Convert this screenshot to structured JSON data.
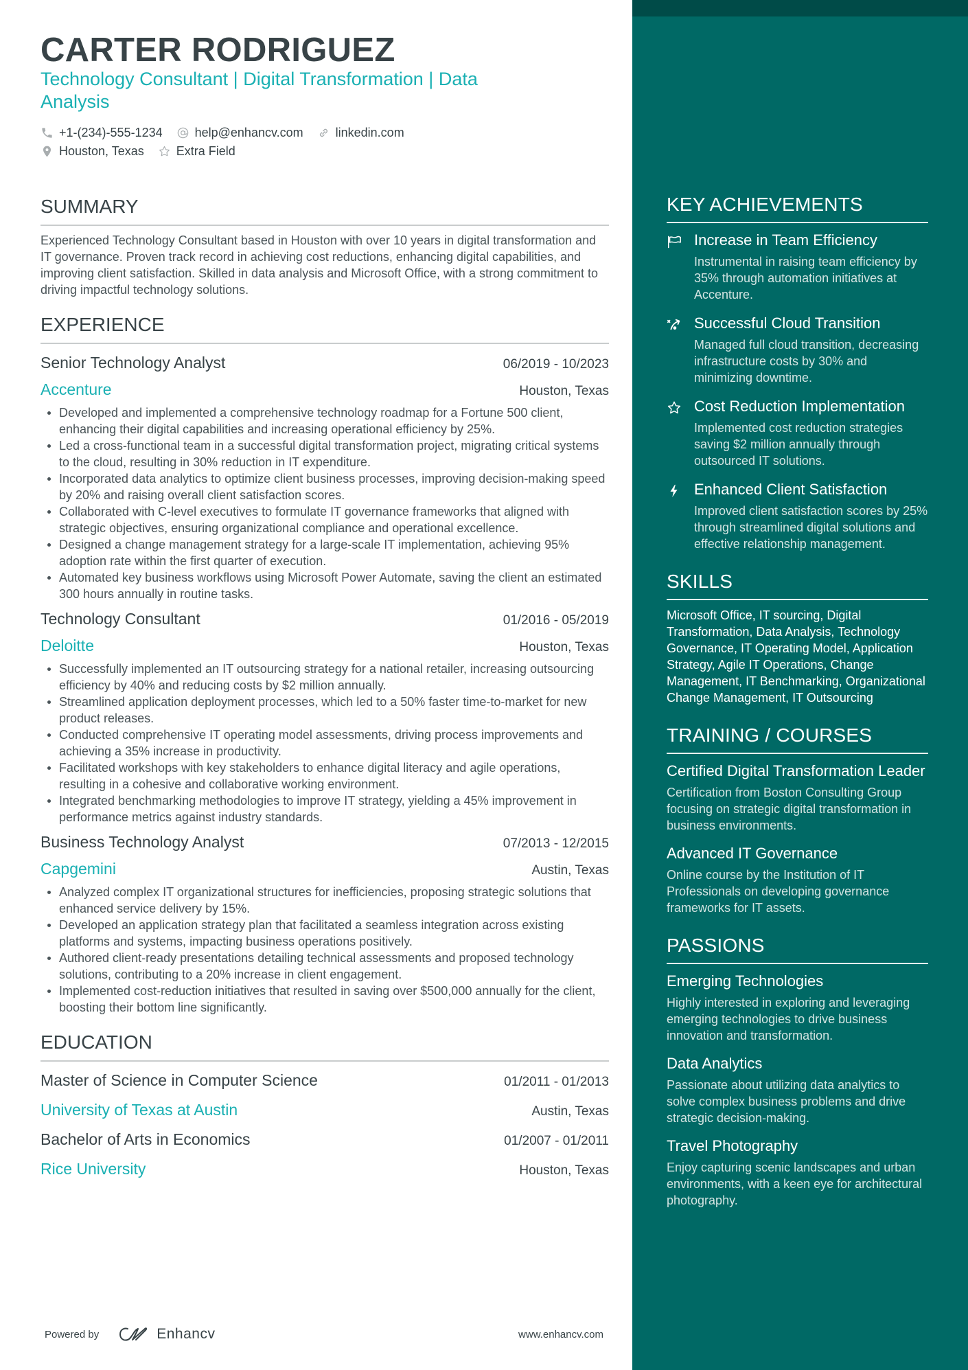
{
  "colors": {
    "accent": "#1ab0b3",
    "text": "#384347",
    "sidebar_bg": "#006965",
    "sidebar_band": "#004b48"
  },
  "header": {
    "name": "CARTER RODRIGUEZ",
    "subtitle": "Technology Consultant | Digital Transformation | Data Analysis",
    "contacts": [
      {
        "icon": "phone-icon",
        "text": "+1-(234)-555-1234"
      },
      {
        "icon": "at-icon",
        "text": "help@enhancv.com"
      },
      {
        "icon": "link-icon",
        "text": "linkedin.com"
      },
      {
        "icon": "location-pin-icon",
        "text": "Houston, Texas"
      },
      {
        "icon": "star-icon",
        "text": "Extra Field"
      }
    ]
  },
  "summary": {
    "heading": "SUMMARY",
    "text": "Experienced Technology Consultant based in Houston with over 10 years in digital transformation and IT governance. Proven track record in achieving cost reductions, enhancing digital capabilities, and improving client satisfaction. Skilled in data analysis and Microsoft Office, with a strong commitment to driving impactful technology solutions."
  },
  "experience": {
    "heading": "EXPERIENCE",
    "jobs": [
      {
        "title": "Senior Technology Analyst",
        "dates": "06/2019 - 10/2023",
        "company": "Accenture",
        "location": "Houston, Texas",
        "bullets": [
          "Developed and implemented a comprehensive technology roadmap for a Fortune 500 client, enhancing their digital capabilities and increasing operational efficiency by 25%.",
          "Led a cross-functional team in a successful digital transformation project, migrating critical systems to the cloud, resulting in 30% reduction in IT expenditure.",
          "Incorporated data analytics to optimize client business processes, improving decision-making speed by 20% and raising overall client satisfaction scores.",
          "Collaborated with C-level executives to formulate IT governance frameworks that aligned with strategic objectives, ensuring organizational compliance and operational excellence.",
          "Designed a change management strategy for a large-scale IT implementation, achieving 95% adoption rate within the first quarter of execution.",
          "Automated key business workflows using Microsoft Power Automate, saving the client an estimated 300 hours annually in routine tasks."
        ]
      },
      {
        "title": "Technology Consultant",
        "dates": "01/2016 - 05/2019",
        "company": "Deloitte",
        "location": "Houston, Texas",
        "bullets": [
          "Successfully implemented an IT outsourcing strategy for a national retailer, increasing outsourcing efficiency by 40% and reducing costs by $2 million annually.",
          "Streamlined application deployment processes, which led to a 50% faster time-to-market for new product releases.",
          "Conducted comprehensive IT operating model assessments, driving process improvements and achieving a 35% increase in productivity.",
          "Facilitated workshops with key stakeholders to enhance digital literacy and agile operations, resulting in a cohesive and collaborative working environment.",
          "Integrated benchmarking methodologies to improve IT strategy, yielding a 45% improvement in performance metrics against industry standards."
        ]
      },
      {
        "title": "Business Technology Analyst",
        "dates": "07/2013 - 12/2015",
        "company": "Capgemini",
        "location": "Austin, Texas",
        "bullets": [
          "Analyzed complex IT organizational structures for inefficiencies, proposing strategic solutions that enhanced service delivery by 15%.",
          "Developed an application strategy plan that facilitated a seamless integration across existing platforms and systems, impacting business operations positively.",
          "Authored client-ready presentations detailing technical assessments and proposed technology solutions, contributing to a 20% increase in client engagement.",
          "Implemented cost-reduction initiatives that resulted in saving over $500,000 annually for the client, boosting their bottom line significantly."
        ]
      }
    ]
  },
  "education": {
    "heading": "EDUCATION",
    "entries": [
      {
        "degree": "Master of Science in Computer Science",
        "dates": "01/2011 - 01/2013",
        "school": "University of Texas at Austin",
        "location": "Austin, Texas"
      },
      {
        "degree": "Bachelor of Arts in Economics",
        "dates": "01/2007 - 01/2011",
        "school": "Rice University",
        "location": "Houston, Texas"
      }
    ]
  },
  "sidebar": {
    "achievements": {
      "heading": "KEY ACHIEVEMENTS",
      "items": [
        {
          "icon": "flag-icon",
          "title": "Increase in Team Efficiency",
          "desc": "Instrumental in raising team efficiency by 35% through automation initiatives at Accenture."
        },
        {
          "icon": "route-arrow-icon",
          "title": "Successful Cloud Transition",
          "desc": "Managed full cloud transition, decreasing infrastructure costs by 30% and minimizing downtime."
        },
        {
          "icon": "star-icon",
          "title": "Cost Reduction Implementation",
          "desc": "Implemented cost reduction strategies saving $2 million annually through outsourced IT solutions."
        },
        {
          "icon": "lightning-icon",
          "title": "Enhanced Client Satisfaction",
          "desc": "Improved client satisfaction scores by 25% through streamlined digital solutions and effective relationship management."
        }
      ]
    },
    "skills": {
      "heading": "SKILLS",
      "text": "Microsoft Office, IT sourcing, Digital Transformation, Data Analysis, Technology Governance, IT Operating Model, Application Strategy, Agile IT Operations, Change Management, IT Benchmarking, Organizational Change Management, IT Outsourcing"
    },
    "training": {
      "heading": "TRAINING / COURSES",
      "items": [
        {
          "title": "Certified Digital Transformation Leader",
          "desc": "Certification from Boston Consulting Group focusing on strategic digital transformation in business environments."
        },
        {
          "title": "Advanced IT Governance",
          "desc": "Online course by the Institution of IT Professionals on developing governance frameworks for IT assets."
        }
      ]
    },
    "passions": {
      "heading": "PASSIONS",
      "items": [
        {
          "title": "Emerging Technologies",
          "desc": "Highly interested in exploring and leveraging emerging technologies to drive business innovation and transformation."
        },
        {
          "title": "Data Analytics",
          "desc": "Passionate about utilizing data analytics to solve complex business problems and drive strategic decision-making."
        },
        {
          "title": "Travel Photography",
          "desc": "Enjoy capturing scenic landscapes and urban environments, with a keen eye for architectural photography."
        }
      ]
    }
  },
  "footer": {
    "powered_by": "Powered by",
    "brand": "Enhancv",
    "url": "www.enhancv.com"
  }
}
